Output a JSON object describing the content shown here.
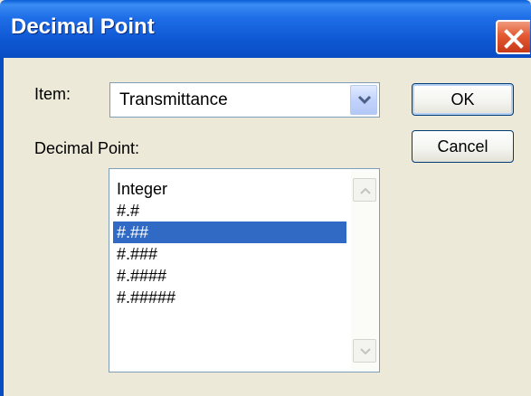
{
  "window": {
    "title": "Decimal Point"
  },
  "item": {
    "label": "Item:",
    "selected_value": "Transmittance"
  },
  "decimal_point": {
    "label": "Decimal Point:",
    "options": [
      "Integer",
      "#.#",
      "#.##",
      "#.###",
      "#.####",
      "#.#####"
    ],
    "selected_index": 2
  },
  "buttons": {
    "ok": "OK",
    "cancel": "Cancel"
  },
  "colors": {
    "title_bar": "#0a4cc4",
    "selection": "#316ac5",
    "dialog_background": "#ece9d8"
  },
  "icons": {
    "close": "close-icon",
    "dropdown": "chevron-down-icon",
    "scroll_up": "chevron-up-icon",
    "scroll_down": "chevron-down-icon"
  }
}
